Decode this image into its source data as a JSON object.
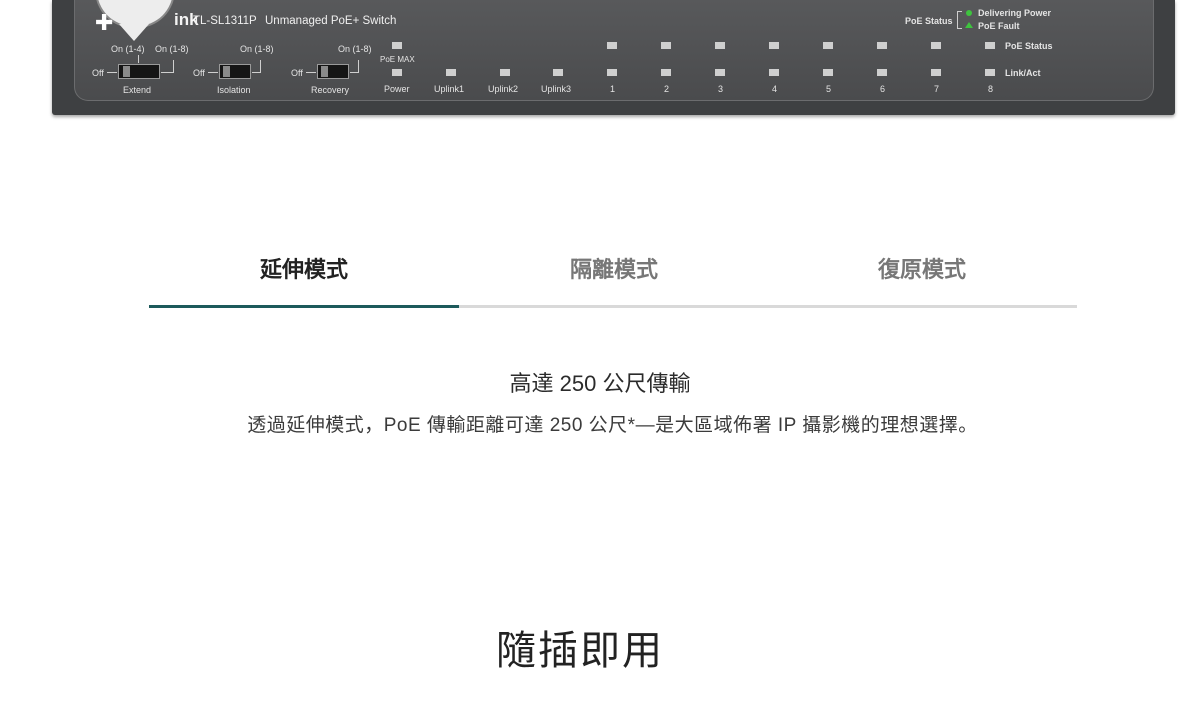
{
  "device": {
    "logo_text": "ink",
    "model": "TL-SL1311P",
    "description": "Unmanaged PoE+ Switch",
    "switches": [
      {
        "on_label_a": "On (1-4)",
        "on_label_b": "On (1-8)",
        "off_label": "Off",
        "name": "Extend"
      },
      {
        "on_label": "On (1-8)",
        "off_label": "Off",
        "name": "Isolation"
      },
      {
        "on_label": "On (1-8)",
        "off_label": "Off",
        "name": "Recovery"
      }
    ],
    "poe_max_label": "PoE MAX",
    "port_labels": [
      "Power",
      "Uplink1",
      "Uplink2",
      "Uplink3",
      "1",
      "2",
      "3",
      "4",
      "5",
      "6",
      "7",
      "8"
    ],
    "legend": {
      "poe_status_label": "PoE Status",
      "delivering_power": "Delivering Power",
      "poe_fault": "PoE Fault",
      "row_poe_status": "PoE Status",
      "row_link_act": "Link/Act"
    },
    "colors": {
      "led_green": "#3ec43e"
    }
  },
  "tabs": [
    {
      "label": "延伸模式",
      "active": true
    },
    {
      "label": "隔離模式",
      "active": false
    },
    {
      "label": "復原模式",
      "active": false
    }
  ],
  "feature": {
    "title": "高達 250 公尺傳輸",
    "description": "透過延伸模式，PoE 傳輸距離可達 250 公尺*—是大區域佈署 IP 攝影機的理想選擇。"
  },
  "next_section": {
    "title": "隨插即用"
  },
  "colors": {
    "tab_active_underline": "#1d5a5b",
    "tab_inactive_underline": "#d9d9d9"
  }
}
